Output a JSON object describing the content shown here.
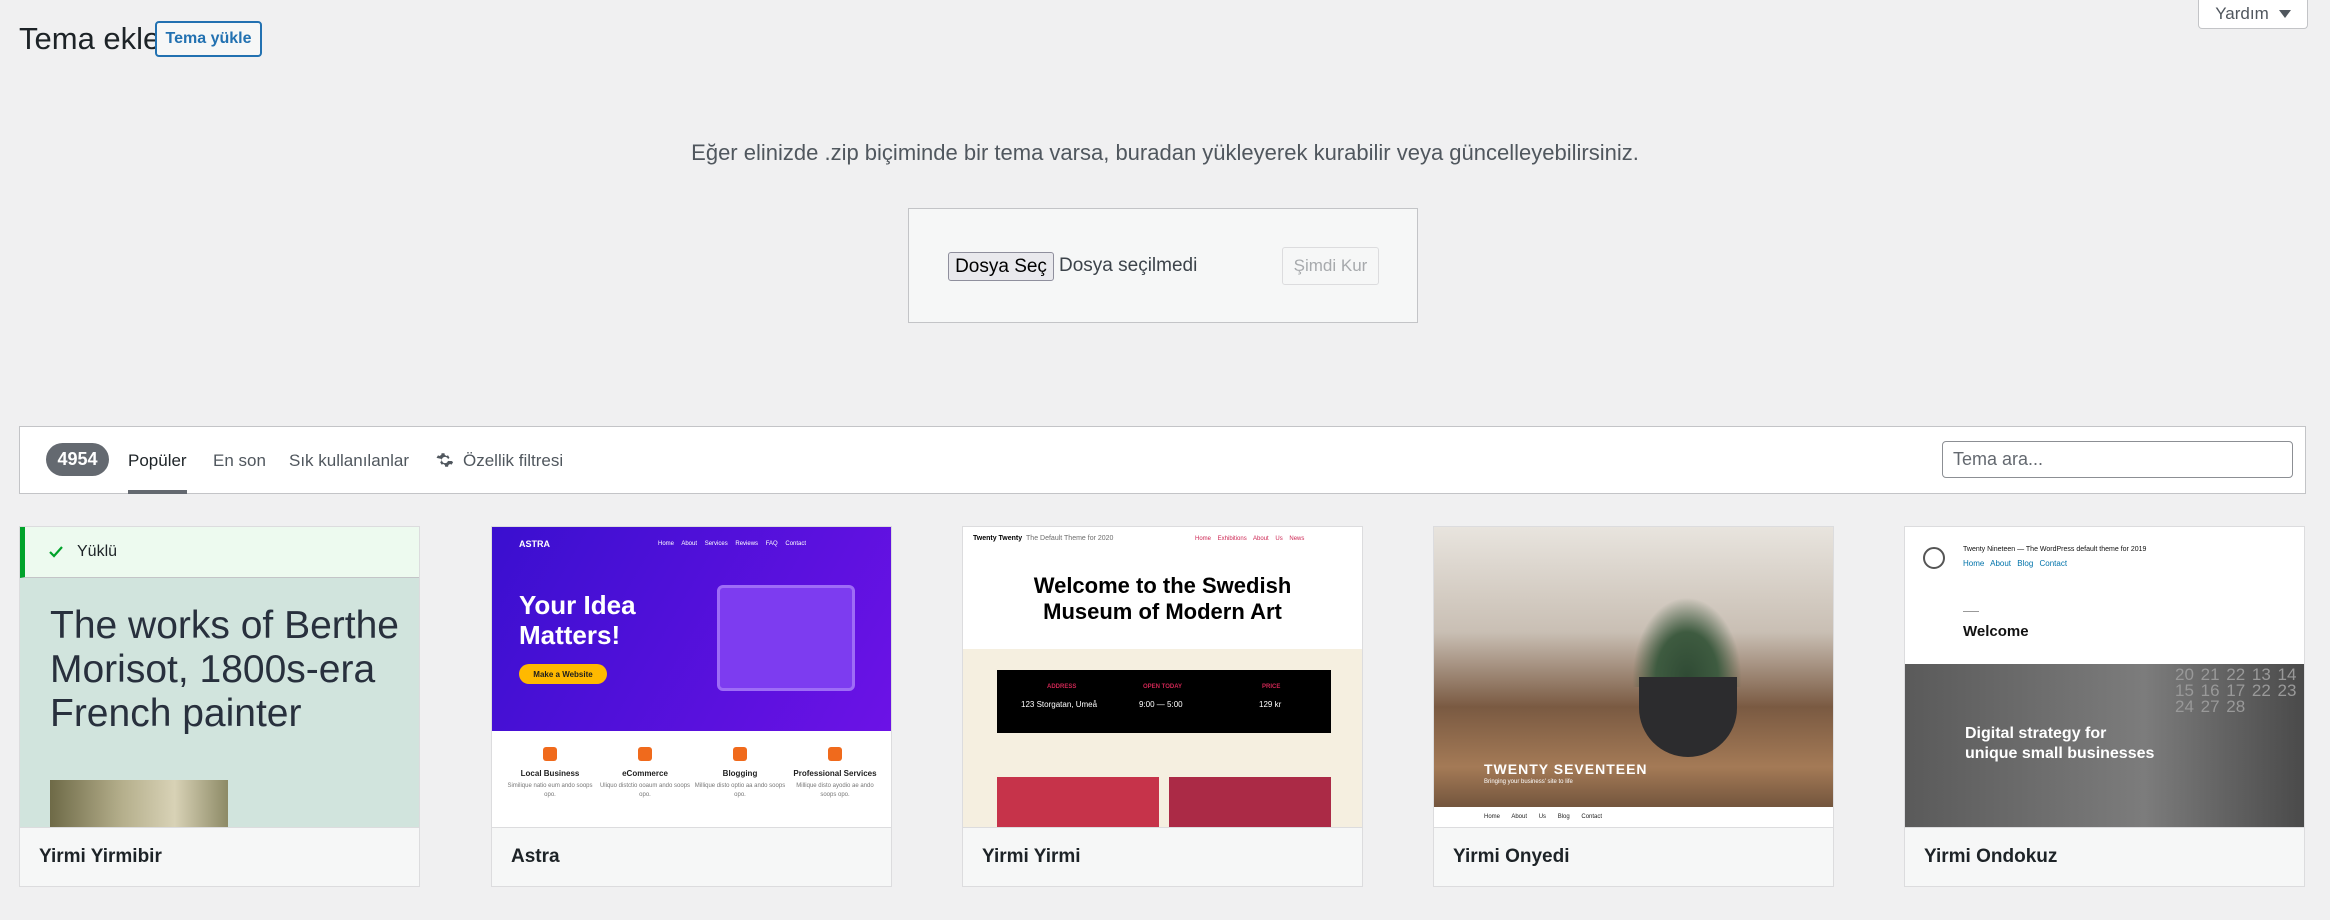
{
  "header": {
    "title": "Tema ekle",
    "upload_button": "Tema yükle",
    "help_tab": "Yardım"
  },
  "upload": {
    "description": "Eğer elinizde .zip biçiminde bir tema varsa, buradan yükleyerek kurabilir veya güncelleyebilirsiniz.",
    "file_button": "Dosya Seç",
    "file_status": "Dosya seçilmedi",
    "install_button": "Şimdi Kur"
  },
  "filters": {
    "count": "4954",
    "tabs": [
      "Popüler",
      "En son",
      "Sık kullanılanlar"
    ],
    "active_tab": "Popüler",
    "feature_filter": "Özellik filtresi",
    "search_placeholder": "Tema ara..."
  },
  "themes": [
    {
      "name": "Yirmi Yirmibir",
      "installed_label": "Yüklü",
      "preview_text": "The works of Berthe Morisot, 1800s-era French painter"
    },
    {
      "name": "Astra",
      "preview": {
        "logo": "ASTRA",
        "nav": "Home About Services Reviews FAQ Contact",
        "headline": "Your Idea Matters!",
        "cta": "Make a Website",
        "services": [
          {
            "title": "Local Business",
            "desc": "Similique natio eum ando soops opo."
          },
          {
            "title": "eCommerce",
            "desc": "Uliquo distctio ooaum ando soops opo."
          },
          {
            "title": "Blogging",
            "desc": "Millique disto optio aa ando soops opo."
          },
          {
            "title": "Professional Services",
            "desc": "Millique disto ayodio ae ando soops opo."
          }
        ]
      }
    },
    {
      "name": "Yirmi Yirmi",
      "preview": {
        "brand": "Twenty Twenty",
        "tagline": "The Default Theme for 2020",
        "nav": "Home Exhibitions About Us News",
        "headline": "Welcome to the Swedish Museum of Modern Art",
        "info": [
          {
            "label": "ADDRESS",
            "value": "123 Storgatan, Umeå"
          },
          {
            "label": "OPEN TODAY",
            "value": "9:00 — 5:00"
          },
          {
            "label": "PRICE",
            "value": "129 kr"
          }
        ]
      }
    },
    {
      "name": "Yirmi Onyedi",
      "preview": {
        "site_name": "TWENTY SEVENTEEN",
        "tagline": "Bringing your business' site to life",
        "nav": "Home About Us Blog Contact"
      }
    },
    {
      "name": "Yirmi Ondokuz",
      "preview": {
        "brand": "Twenty Nineteen — The WordPress default theme for 2019",
        "nav": "Home About Blog Contact",
        "welcome": "Welcome",
        "strategy": "Digital strategy for unique small businesses",
        "calendar": "20 21 22 13 14 15 16 17 22 23 24 27 28"
      }
    }
  ],
  "colors": {
    "accent": "#2271b1",
    "installed": "#00a32a",
    "badge": "#646970"
  }
}
